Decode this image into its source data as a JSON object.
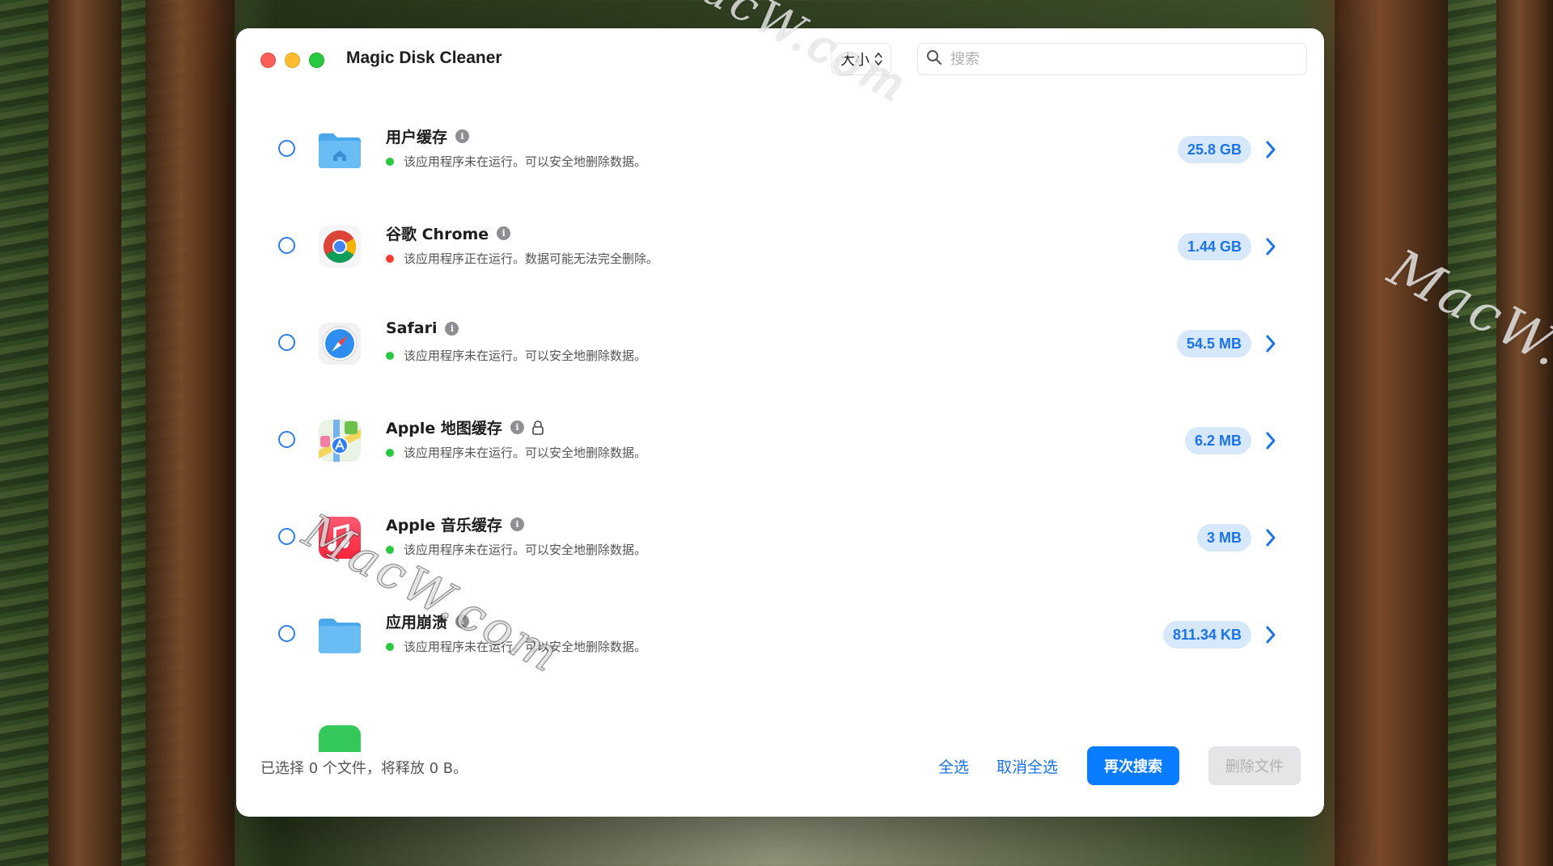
{
  "window": {
    "title": "Magic Disk Cleaner",
    "sort_label": "大小",
    "search_placeholder": "搜索"
  },
  "items": [
    {
      "name": "用户缓存",
      "status": "该应用程序未在运行。可以安全地删除数据。",
      "status_color": "#28c840",
      "size": "25.8 GB",
      "icon": "home-folder-icon",
      "locked": false
    },
    {
      "name": "谷歌 Chrome",
      "status": "该应用程序正在运行。数据可能无法完全删除。",
      "status_color": "#ff3b30",
      "size": "1.44 GB",
      "icon": "chrome-icon",
      "locked": false
    },
    {
      "name": "Safari",
      "status": "该应用程序未在运行。可以安全地删除数据。",
      "status_color": "#28c840",
      "size": "54.5 MB",
      "icon": "safari-icon",
      "locked": false
    },
    {
      "name": "Apple 地图缓存",
      "status": "该应用程序未在运行。可以安全地删除数据。",
      "status_color": "#28c840",
      "size": "6.2 MB",
      "icon": "maps-icon",
      "locked": true
    },
    {
      "name": "Apple 音乐缓存",
      "status": "该应用程序未在运行。可以安全地删除数据。",
      "status_color": "#28c840",
      "size": "3 MB",
      "icon": "music-icon",
      "locked": false
    },
    {
      "name": "应用崩溃",
      "status": "该应用程序未在运行。可以安全地删除数据。",
      "status_color": "#28c840",
      "size": "811.34 KB",
      "icon": "folder-icon",
      "locked": false
    }
  ],
  "footer": {
    "status": "已选择 0 个文件，将释放 0 B。",
    "select_all": "全选",
    "deselect_all": "取消全选",
    "rescan": "再次搜索",
    "delete": "删除文件"
  },
  "watermark": "MacW.com",
  "colors": {
    "accent": "#0a7cff",
    "badge_bg": "#d8e8fb",
    "badge_text": "#1a73e8",
    "ok": "#28c840",
    "warn": "#ff3b30"
  }
}
